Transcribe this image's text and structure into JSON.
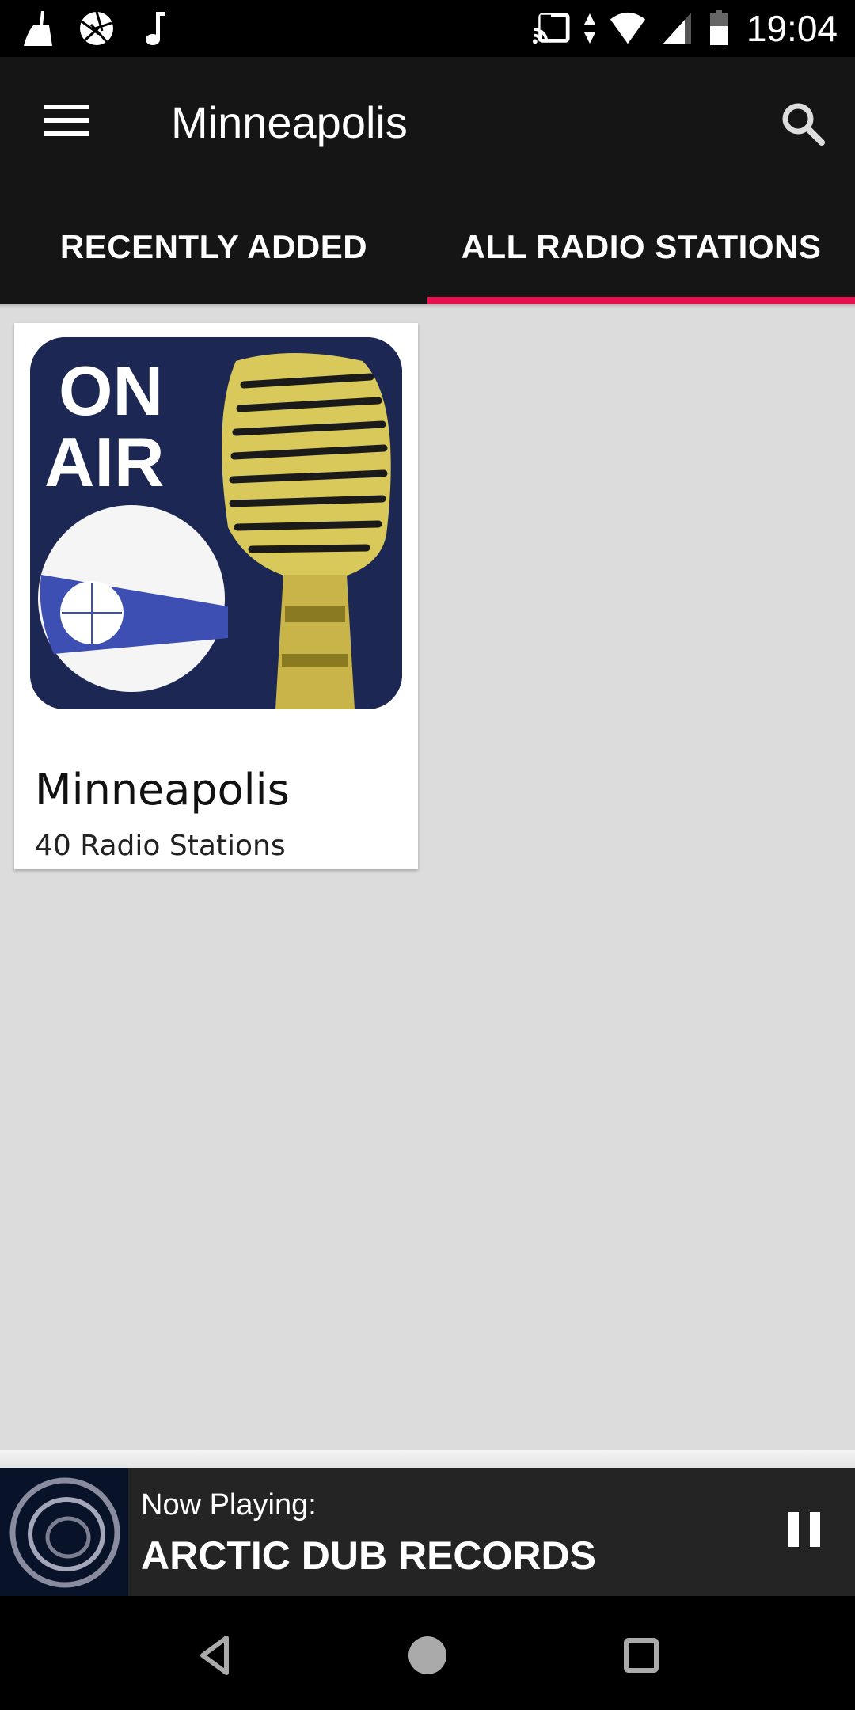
{
  "status_bar": {
    "left_icons": [
      "cleaner-icon",
      "aperture-icon",
      "music-note-icon"
    ],
    "right_icons": [
      "cast-icon",
      "data-arrows-icon",
      "wifi-icon",
      "signal-icon",
      "battery-icon"
    ],
    "time": "19:04"
  },
  "toolbar": {
    "title": "Minneapolis",
    "menu_icon": "hamburger-menu-icon",
    "search_icon": "search-icon"
  },
  "tabs": [
    {
      "label": "RECENTLY ADDED",
      "active": false
    },
    {
      "label": "ALL RADIO STATIONS",
      "active": true
    }
  ],
  "accent_color": "#e8114f",
  "cards": [
    {
      "image_text_line1": "ON",
      "image_text_line2": "AIR",
      "title": "Minneapolis",
      "subtitle": "40 Radio Stations"
    }
  ],
  "player": {
    "label": "Now Playing:",
    "station": "ARCTIC DUB RECORDS",
    "state": "playing",
    "control_icon": "pause-icon"
  },
  "nav_bar": {
    "buttons": [
      "back-icon",
      "home-icon",
      "recents-icon"
    ]
  }
}
